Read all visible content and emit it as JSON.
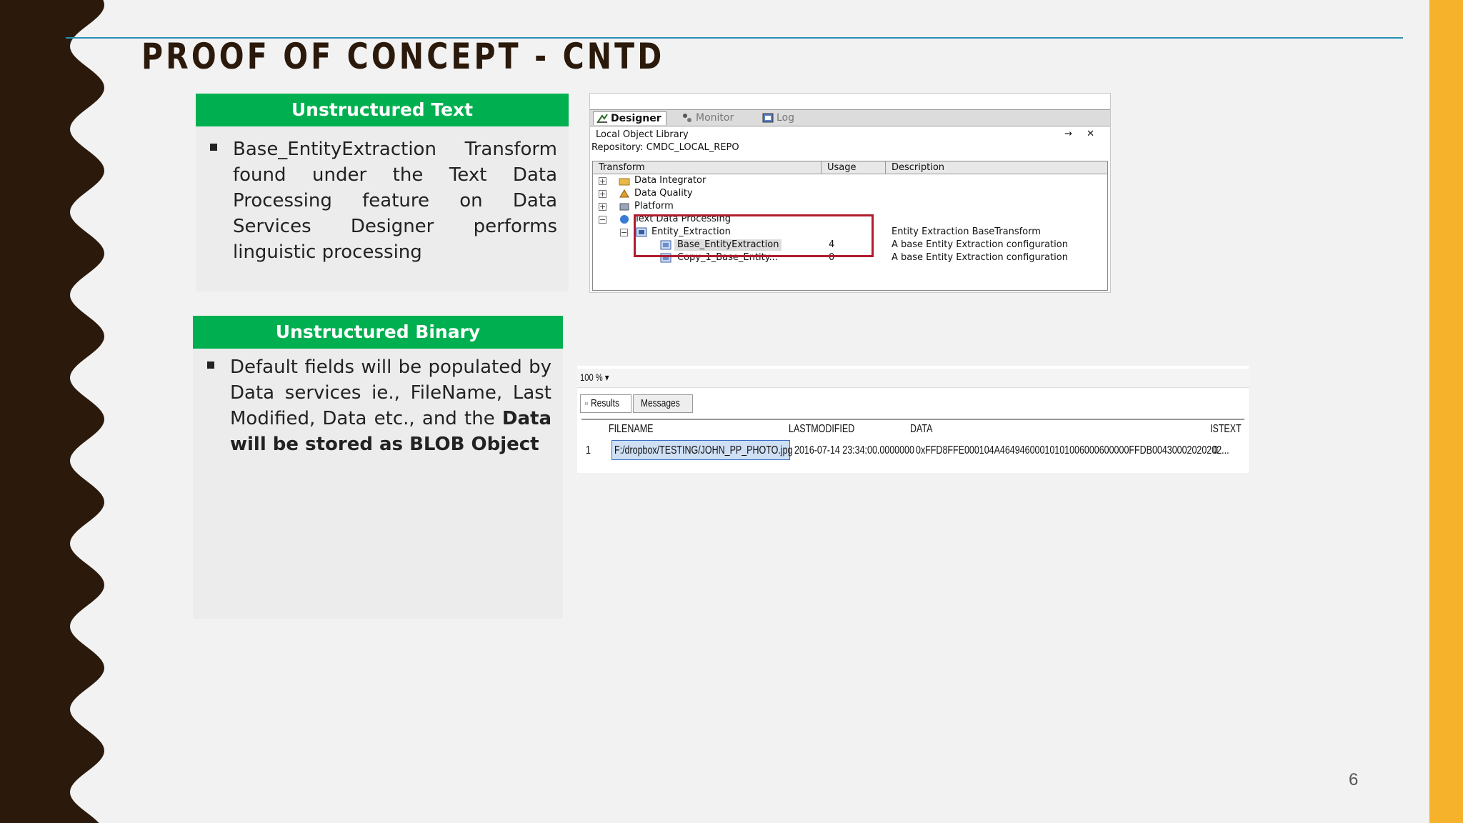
{
  "slide": {
    "title": "PROOF OF CONCEPT - CNTD",
    "page_number": "6",
    "colors": {
      "accent_green": "#00b050",
      "side_band": "#f7b22b",
      "left_band": "#2b1a0b",
      "highlight_box": "#b01c2e"
    }
  },
  "panel_text": {
    "heading": "Unstructured Text",
    "bullet": "Base_EntityExtraction Transform found under the Text Data Processing feature on Data Services Designer performs linguistic processing"
  },
  "panel_binary": {
    "heading": "Unstructured Binary",
    "bullet_prefix": "Default fields will be populated by Data services ie., FileName, Last Modified, Data etc., and the ",
    "bullet_bold": "Data will be stored as BLOB Object"
  },
  "designer_screenshot": {
    "tabs": [
      "Designer",
      "Monitor",
      "Log"
    ],
    "library_title": "Local Object Library",
    "library_controls": "→ ✕",
    "repository": "Repository: CMDC_LOCAL_REPO",
    "columns": [
      "Transform",
      "Usage",
      "Description"
    ],
    "rows": [
      {
        "name": "Data Integrator",
        "usage": "",
        "description": ""
      },
      {
        "name": "Data Quality",
        "usage": "",
        "description": ""
      },
      {
        "name": "Platform",
        "usage": "",
        "description": ""
      },
      {
        "name": "Text Data Processing",
        "usage": "",
        "description": ""
      },
      {
        "name": "Entity_Extraction",
        "usage": "",
        "description": "Entity Extraction BaseTransform"
      },
      {
        "name": "Base_EntityExtraction",
        "usage": "4",
        "description": "A base Entity Extraction configuration"
      },
      {
        "name": "Copy_1_Base_Entity...",
        "usage": "0",
        "description": "A base Entity Extraction configuration"
      }
    ]
  },
  "query_results_screenshot": {
    "zoom": "100 %",
    "tabs": [
      "Results",
      "Messages"
    ],
    "columns": [
      "FILENAME",
      "LASTMODIFIED",
      "DATA",
      "ISTEXT"
    ],
    "row": {
      "index": "1",
      "filename": "F:/dropbox/TESTING/JOHN_PP_PHOTO.jpg",
      "lastmodified": "2016-07-14 23:34:00.0000000",
      "data": "0xFFD8FFE000104A46494600010101006000600000FFDB00430002020202...",
      "istext": "0"
    }
  }
}
